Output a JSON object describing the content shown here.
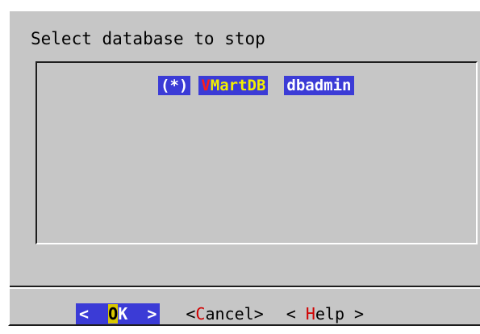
{
  "dialog": {
    "title": "Select database to stop"
  },
  "list": {
    "items": [
      {
        "radio": "(*)",
        "name_hotkey": "V",
        "name_rest": "MartDB",
        "owner": "dbadmin"
      }
    ]
  },
  "buttons": {
    "ok": {
      "left": "<",
      "hotkey": "O",
      "rest": "K",
      "right": ">"
    },
    "cancel": {
      "left": "<",
      "hotkey": "C",
      "rest": "ancel",
      "right": ">"
    },
    "help": {
      "left": "< ",
      "hotkey": "H",
      "rest": "elp",
      "right": " >"
    }
  },
  "colors": {
    "dialog_bg": "#c6c6c6",
    "highlight_bg": "#3b3bd6",
    "hotkey_red": "#ff1a1a",
    "selected_name": "#f4f000"
  }
}
